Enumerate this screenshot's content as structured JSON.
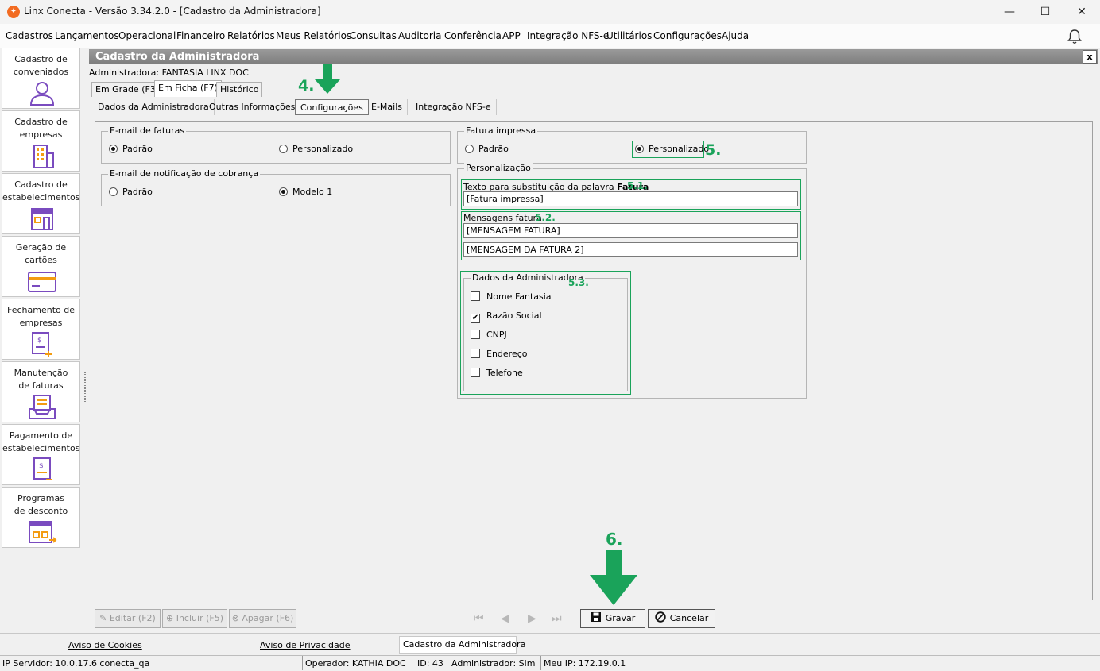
{
  "window": {
    "title": "Linx Conecta - Versão 3.34.2.0 - [Cadastro da Administradora]",
    "minimize": "—",
    "maximize": "☐",
    "close": "✕"
  },
  "menu": [
    "Cadastros",
    "Lançamentos",
    "Operacional",
    "Financeiro",
    "Relatórios",
    "Meus Relatórios",
    "Consultas",
    "Auditoria",
    "Conferência",
    "APP",
    "Integração NFS-e",
    "Utilitários",
    "Configurações",
    "Ajuda"
  ],
  "sidebar": {
    "items": [
      {
        "line1": "Cadastro de",
        "line2": "conveniados",
        "icon": "user-icon"
      },
      {
        "line1": "Cadastro de",
        "line2": "empresas",
        "icon": "building-icon"
      },
      {
        "line1": "Cadastro de",
        "line2": "estabelecimentos",
        "icon": "store-icon"
      },
      {
        "line1": "Geração de",
        "line2": "cartões",
        "icon": "card-icon"
      },
      {
        "line1": "Fechamento de",
        "line2": "empresas",
        "icon": "invoice-add-icon"
      },
      {
        "line1": "Manutenção",
        "line2": "de faturas",
        "icon": "inbox-tray-icon"
      },
      {
        "line1": "Pagamento de",
        "line2": "estabelecimentos",
        "icon": "payment-doc-icon"
      },
      {
        "line1": "Programas",
        "line2": "de desconto",
        "icon": "discount-program-icon"
      }
    ]
  },
  "form": {
    "title": "Cadastro da Administradora",
    "close": "x",
    "administradora_label": "Administradora: FANTASIA LINX DOC",
    "view_tabs": [
      "Em Grade (F3)",
      "Em Ficha (F7)",
      "Histórico"
    ],
    "section_tabs": [
      "Dados da Administradora",
      "Outras Informações",
      "Configurações",
      "E-Mails",
      "Integração NFS-e"
    ],
    "email_faturas": {
      "title": "E-mail de faturas",
      "opt1": "Padrão",
      "opt2": "Personalizado",
      "selected": "Padrão"
    },
    "email_cobranca": {
      "title": "E-mail de notificação de cobrança",
      "opt1": "Padrão",
      "opt2": "Modelo 1",
      "selected": "Modelo 1"
    },
    "fatura_impressa": {
      "title": "Fatura impressa",
      "opt1": "Padrão",
      "opt2": "Personalizado",
      "selected": "Personalizado"
    },
    "personalizacao": {
      "title": "Personalização",
      "texto_label": "Texto para substituição da palavra ",
      "texto_bold": "Fatura",
      "texto_value": "[Fatura impressa]",
      "mensagens_label": "Mensagens fatura",
      "msg1": "[MENSAGEM FATURA]",
      "msg2": "[MENSAGEM DA FATURA 2]",
      "dados_title": "Dados da Administradora",
      "checks": [
        {
          "label": "Nome Fantasia",
          "checked": false
        },
        {
          "label": "Razão Social",
          "checked": true
        },
        {
          "label": "CNPJ",
          "checked": false
        },
        {
          "label": "Endereço",
          "checked": false
        },
        {
          "label": "Telefone",
          "checked": false
        }
      ]
    },
    "annotations": {
      "a4": "4.",
      "a5": "5.",
      "a51": "5.1.",
      "a52": "5.2.",
      "a53": "5.3.",
      "a6": "6."
    },
    "buttons": {
      "editar": "Editar (F2)",
      "incluir": "Incluir (F5)",
      "apagar": "Apagar (F6)",
      "gravar": "Gravar",
      "cancelar": "Cancelar"
    },
    "nav": [
      "⏮",
      "◀",
      "▶",
      "⏭"
    ]
  },
  "footer": {
    "cookies": "Aviso de Cookies",
    "privacidade": "Aviso de Privacidade",
    "open_tab": "Cadastro da Administradora"
  },
  "status": {
    "ip_servidor": "IP Servidor: 10.0.17.6 conecta_qa",
    "operador": "Operador: KATHIA DOC",
    "id": "ID: 43",
    "admin": "Administrador: Sim",
    "meu_ip": "Meu IP: 172.19.0.1"
  },
  "colors": {
    "annotation_green": "#1aa35a",
    "icon_purple": "#7a4bbf",
    "icon_orange": "#f39c12"
  }
}
